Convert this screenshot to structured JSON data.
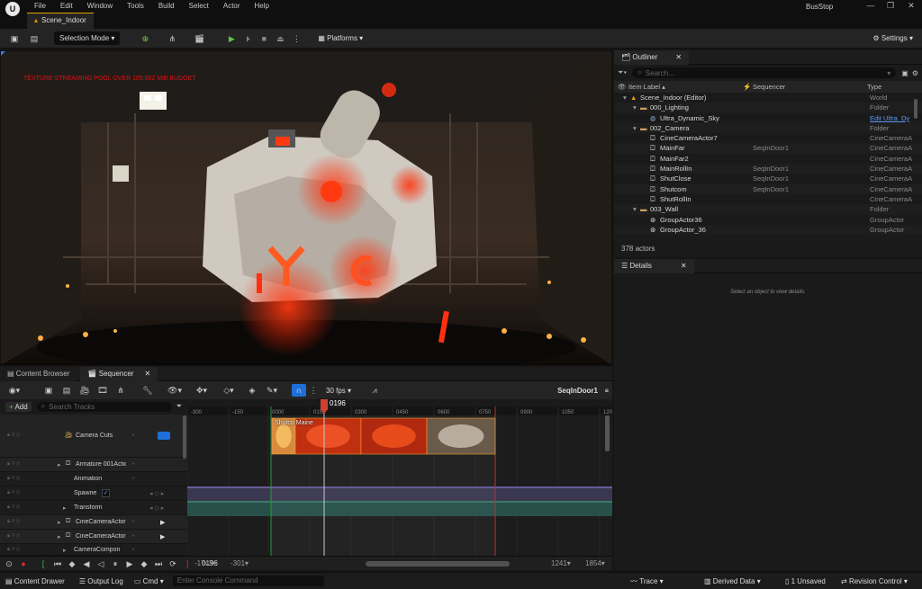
{
  "app": {
    "logo": "U",
    "project_name": "BusStop",
    "window_controls": [
      "—",
      "❐",
      "✕"
    ]
  },
  "menu": [
    "File",
    "Edit",
    "Window",
    "Tools",
    "Build",
    "Select",
    "Actor",
    "Help"
  ],
  "document_tab": "Scene_Indoor",
  "toolbar": {
    "selection_mode": "Selection Mode ▾",
    "platforms": "Platforms ▾",
    "settings": "Settings ▾"
  },
  "viewport": {
    "warning": "TEXTURE STREAMING POOL OVER 105.662 MiB BUDGET"
  },
  "outliner": {
    "tab": "Outliner",
    "search_placeholder": "Search...",
    "columns": {
      "label": "Item Label ▴",
      "sequencer": "Sequencer",
      "type": "Type"
    },
    "rows": [
      {
        "indent": 0,
        "icon": "level",
        "label": "Scene_Indoor (Editor)",
        "seq": "",
        "type": "World"
      },
      {
        "indent": 1,
        "icon": "folder",
        "label": "000_Lighting",
        "seq": "",
        "type": "Folder"
      },
      {
        "indent": 2,
        "icon": "sky",
        "label": "Ultra_Dynamic_Sky",
        "seq": "",
        "type": "Edit Ultra_Dy",
        "link": true
      },
      {
        "indent": 1,
        "icon": "folder",
        "label": "002_Camera",
        "seq": "",
        "type": "Folder"
      },
      {
        "indent": 2,
        "icon": "camera",
        "label": "CineCameraActor7",
        "seq": "",
        "type": "CineCameraA"
      },
      {
        "indent": 2,
        "icon": "camera",
        "label": "MainFar",
        "seq": "SeqInDoor1",
        "type": "CineCameraA"
      },
      {
        "indent": 2,
        "icon": "camera",
        "label": "MainFar2",
        "seq": "",
        "type": "CineCameraA"
      },
      {
        "indent": 2,
        "icon": "camera",
        "label": "MainRollIn",
        "seq": "SeqInDoor1",
        "type": "CineCameraA"
      },
      {
        "indent": 2,
        "icon": "camera",
        "label": "ShutClose",
        "seq": "SeqInDoor1",
        "type": "CineCameraA"
      },
      {
        "indent": 2,
        "icon": "camera",
        "label": "Shutcom",
        "seq": "SeqInDoor1",
        "type": "CineCameraA"
      },
      {
        "indent": 2,
        "icon": "camera",
        "label": "ShutRollIn",
        "seq": "",
        "type": "CineCameraA"
      },
      {
        "indent": 1,
        "icon": "folder",
        "label": "003_Wall",
        "seq": "",
        "type": "Folder"
      },
      {
        "indent": 2,
        "icon": "group",
        "label": "GroupActor36",
        "seq": "",
        "type": "GroupActor"
      },
      {
        "indent": 2,
        "icon": "group",
        "label": "GroupActor_36",
        "seq": "",
        "type": "GroupActor"
      }
    ],
    "count": "378 actors"
  },
  "details": {
    "tab": "Details",
    "empty": "Select an object to view details."
  },
  "bottom_tabs": {
    "content_browser": "Content Browser",
    "sequencer": "Sequencer"
  },
  "sequencer": {
    "fps": "30 fps ▾",
    "sequence_name": "SeqInDoor1",
    "add": "Add",
    "search_placeholder": "Search Tracks",
    "current_frame": "0196",
    "frame_field": "0196",
    "ruler": [
      "-300",
      "-150",
      "0000",
      "0150",
      "0300",
      "0450",
      "0600",
      "0750",
      "0900",
      "1050",
      "120"
    ],
    "tracks": [
      {
        "label": "Camera Cuts",
        "indent": 0
      },
      {
        "label": "Armature 001Actio",
        "indent": 1
      },
      {
        "label": "Animation",
        "indent": 2
      },
      {
        "label": "Spawne",
        "indent": 2,
        "checked": true
      },
      {
        "label": "Transform",
        "indent": 2
      },
      {
        "label": "CineCameraActor5",
        "indent": 1
      },
      {
        "label": "CineCameraActor2",
        "indent": 1
      },
      {
        "label": "CameraCompon",
        "indent": 2
      }
    ],
    "shot_label": "Shutco Maine",
    "range": {
      "start_out": "-1743▾",
      "start_in": "-301▾",
      "end_in": "1241▾",
      "end_out": "1854▾"
    }
  },
  "statusbar": {
    "content_drawer": "Content Drawer",
    "output_log": "Output Log",
    "cmd": "Cmd ▾",
    "console_placeholder": "Enter Console Command",
    "trace": "Trace ▾",
    "derived_data": "Derived Data ▾",
    "unsaved": "1 Unsaved",
    "revision": "Revision Control ▾"
  }
}
